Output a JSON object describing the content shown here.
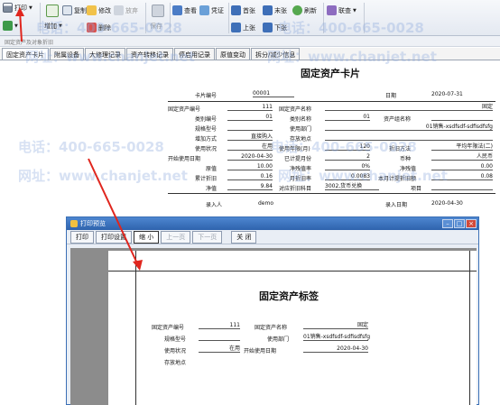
{
  "toolbar": {
    "print": "打印",
    "add": "增加",
    "copy": "复制",
    "modify": "修改",
    "abandon": "放弃",
    "save": "保存",
    "delete": "删除",
    "view": "查看",
    "voucher": "凭证",
    "first": "首张",
    "last": "末张",
    "refresh": "刷新",
    "link": "联查",
    "prev": "上张",
    "next": "下张"
  },
  "subbar": {
    "text": "固定资产及对象折旧"
  },
  "tabs": [
    "固定资产卡片",
    "附属设备",
    "大修理记录",
    "资产转移记录",
    "停启用记录",
    "原值变动",
    "拆分/减少信息"
  ],
  "card": {
    "title": "固定资产卡片",
    "card_no_label": "卡片编号",
    "card_no": "00001",
    "date_label": "日期",
    "date": "2020-07-31",
    "asset_no_label": "固定资产编号",
    "asset_no": "111",
    "asset_name_label": "固定资产名称",
    "asset_name": "固定",
    "cat_no_label": "类别编号",
    "cat_no": "01",
    "cat_name_label": "类别名称",
    "cat_name": "01",
    "asset_group_label": "资产组名称",
    "spec_label": "规格型号",
    "dept_label": "使用部门",
    "dept": "01销售-xsdfsdf-sdfisdfsfg",
    "add_method_label": "增加方式",
    "add_method": "直接购入",
    "location_label": "存放地点",
    "status_label": "使用状况",
    "status": "在用",
    "life_label": "使用年限(月)",
    "life": "120",
    "dep_method_label": "折旧方法",
    "dep_method": "平均年限法(二)",
    "start_label": "开始使用日期",
    "start": "2020-04-30",
    "used_label": "已计提月份",
    "used": "2",
    "currency_label": "币种",
    "currency": "人民币",
    "orig_label": "原值",
    "orig": "10.00",
    "salvage_rate_label": "净残值率",
    "salvage_rate": "0%",
    "salvage_label": "净残值",
    "salvage": "0.00",
    "acc_dep_label": "累计折旧",
    "acc_dep": "0.16",
    "monthly_rate_label": "月折旧率",
    "monthly_rate": "0.0083",
    "monthly_dep_label": "本月计提折旧额",
    "monthly_dep": "0.08",
    "net_label": "净值",
    "net": "9.84",
    "subject_label": "对应折旧科目",
    "subject": "3002,货币兑换",
    "item_label": "项目",
    "entry_label": "录入人",
    "entry": "demo",
    "entry_date_label": "录入日期",
    "entry_date": "2020-04-30"
  },
  "watermark": {
    "phone": "电话：400-665-0028",
    "url": "网址：www.chanjet.net"
  },
  "dialog": {
    "title": "打印预览",
    "buttons": {
      "print": "打印",
      "setup": "打印设置",
      "zoom": "缩 小",
      "prev": "上一页",
      "next": "下一页",
      "close": "关 闭"
    },
    "label": {
      "title": "固定资产标签",
      "asset_no_label": "固定资产编号",
      "asset_no": "111",
      "asset_name_label": "固定资产名称",
      "asset_name": "固定",
      "spec_label": "规格型号",
      "dept_label": "使用部门",
      "dept": "01销售-xsdfsdf-sdfisdfsfg",
      "status_label": "使用状况",
      "status": "在用",
      "start_label": "开始使用日期",
      "start": "2020-04-30",
      "location_label": "存放地点"
    }
  },
  "colors": {
    "accent": "#2f63ad",
    "arrow": "#e0261e"
  }
}
